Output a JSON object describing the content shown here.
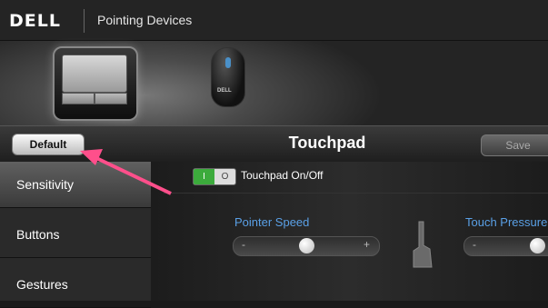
{
  "window": {
    "logo": "DELL",
    "title": "Pointing Devices"
  },
  "devices": [
    {
      "name": "Touchpad",
      "selected": true,
      "icon": "touchpad-icon"
    },
    {
      "name": "Mouse",
      "selected": false,
      "icon": "mouse-icon"
    }
  ],
  "toolbar": {
    "default_label": "Default",
    "panel_title": "Touchpad",
    "save_label": "Save"
  },
  "sidebar": {
    "items": [
      {
        "label": "Sensitivity",
        "active": true
      },
      {
        "label": "Buttons",
        "active": false
      },
      {
        "label": "Gestures",
        "active": false
      }
    ]
  },
  "content": {
    "toggle": {
      "on_text": "I",
      "off_text": "O",
      "label": "Touchpad On/Off",
      "state": "on"
    },
    "pointer_speed": {
      "label": "Pointer Speed",
      "minus": "-",
      "plus": "+",
      "level": 0.5
    },
    "touch_pressure": {
      "label": "Touch Pressure",
      "minus": "-"
    }
  },
  "colors": {
    "accent": "#5aa0e6",
    "toggle_on": "#3cab3c",
    "annotation_arrow": "#ff4f8b"
  }
}
